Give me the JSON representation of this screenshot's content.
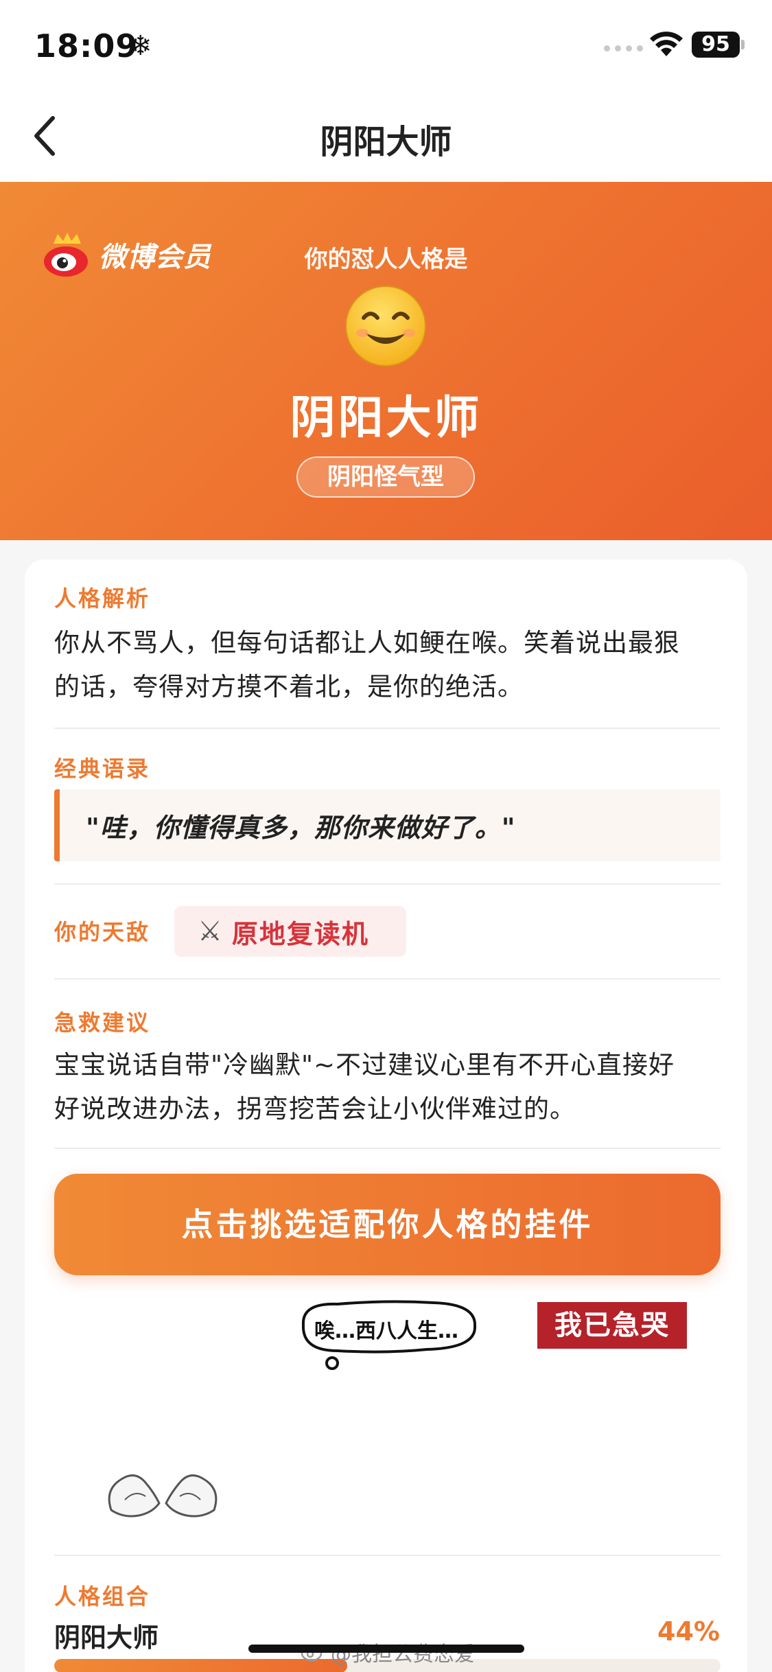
{
  "status_bar": {
    "time": "18:09",
    "battery": "95"
  },
  "nav": {
    "title": "阴阳大师"
  },
  "hero": {
    "brand": "微博会员",
    "subtitle": "你的怼人人格是",
    "emoji": "smiling-face-icon",
    "title": "阴阳大师",
    "tag": "阴阳怪气型"
  },
  "analysis": {
    "label": "人格解析",
    "lines": [
      "你从不骂人，但每句话都让人如鲠在喉。笑着说出最狠",
      "的话，夸得对方摸不着北，是你的绝活。"
    ]
  },
  "quote": {
    "label": "经典语录",
    "text": "\"哇，你懂得真多，那你来做好了。\""
  },
  "enemy": {
    "label": "你的天敌",
    "icon": "crossed-swords-icon",
    "text": "原地复读机"
  },
  "advice": {
    "label": "急救建议",
    "lines": [
      "宝宝说话自带\"冷幽默\"~不过建议心里有不开心直接好",
      "好说改进办法，拐弯挖苦会让小伙伴难过的。"
    ]
  },
  "cta": {
    "label": "点击挑选适配你人格的挂件"
  },
  "stickers": {
    "bubble_text": "唉…西八人生…",
    "red_text": "我已急哭"
  },
  "combo": {
    "label": "人格组合",
    "name": "阴阳大师",
    "percent": "44%",
    "fill": 0.44
  },
  "watermark": {
    "text": "@我担公费恋爱"
  },
  "colors": {
    "accent": "#ee7a30",
    "enemy_red": "#d6333a",
    "sticker_red": "#b5222a"
  }
}
